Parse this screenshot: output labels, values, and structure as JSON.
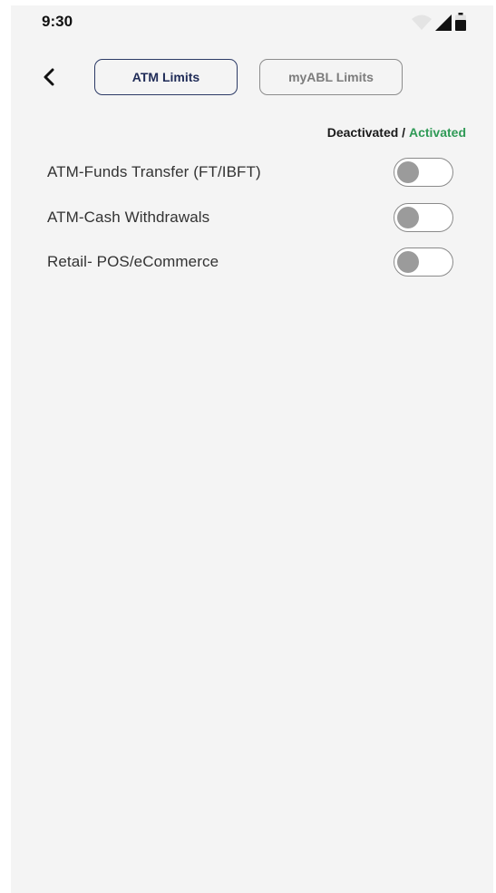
{
  "status_bar": {
    "time": "9:30",
    "icons": [
      "wifi-icon",
      "cellular-signal-icon",
      "battery-icon"
    ]
  },
  "header": {
    "back_icon": "chevron-left-icon",
    "tabs": [
      {
        "label": "ATM Limits",
        "selected": true
      },
      {
        "label": "myABL Limits",
        "selected": false
      }
    ]
  },
  "legend": {
    "deactivated": "Deactivated",
    "separator": " / ",
    "activated": "Activated",
    "activated_color": "#2f9a56"
  },
  "limits": [
    {
      "label": "ATM-Funds Transfer (FT/IBFT)",
      "enabled": false
    },
    {
      "label": "ATM-Cash Withdrawals",
      "enabled": false
    },
    {
      "label": "Retail- POS/eCommerce",
      "enabled": false
    }
  ],
  "colors": {
    "background": "#f4f4f4",
    "active_tab_border": "#2c3a66",
    "inactive_tab_border": "#8c8c8c"
  }
}
